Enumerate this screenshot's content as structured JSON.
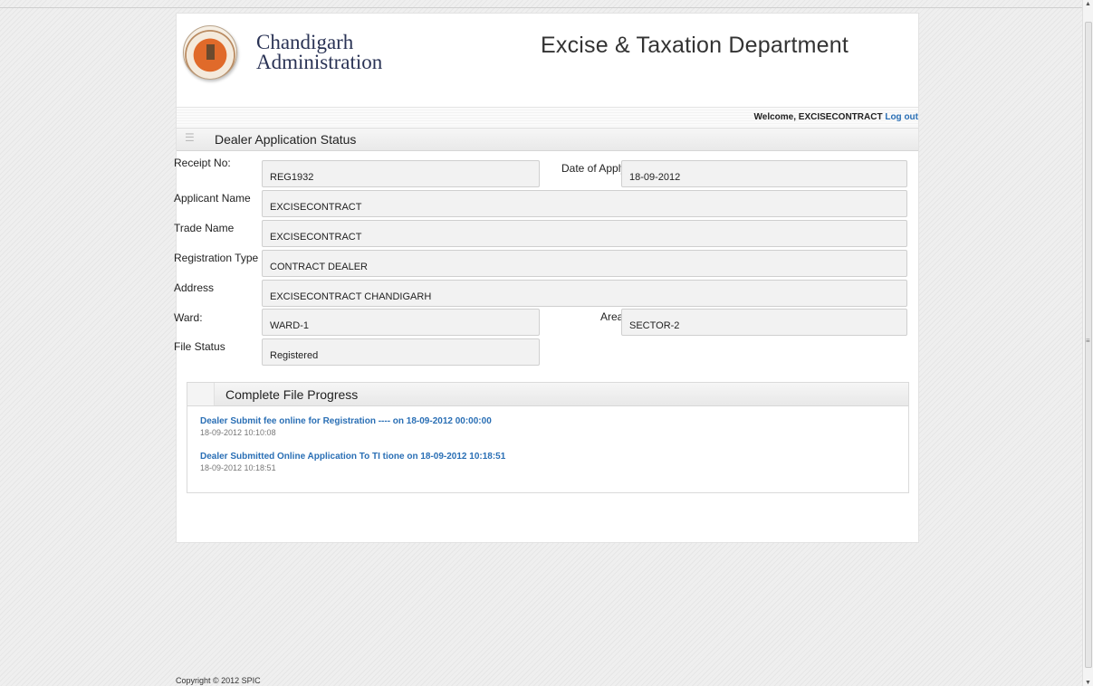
{
  "header": {
    "org_line1": "Chandigarh",
    "org_line2": "Administration",
    "department": "Excise & Taxation Department"
  },
  "welcome": {
    "text": "Welcome, EXCISECONTRACT",
    "logout": "Log out"
  },
  "section": {
    "title": "Dealer Application Status"
  },
  "form": {
    "receipt_label": "Receipt No:",
    "receipt_value": "REG1932",
    "date_label": "Date of Apply",
    "date_value": "18-09-2012",
    "applicant_label": "Applicant Name",
    "applicant_value": "EXCISECONTRACT",
    "trade_label": "Trade Name",
    "trade_value": "EXCISECONTRACT",
    "regtype_label": "Registration Type",
    "regtype_value": "CONTRACT DEALER",
    "address_label": "Address",
    "address_value": "EXCISECONTRACT CHANDIGARH",
    "ward_label": "Ward:",
    "ward_value": "WARD-1",
    "area_label": "Area",
    "area_value": "SECTOR-2",
    "status_label": "File Status",
    "status_value": "Registered"
  },
  "progress": {
    "title": "Complete File Progress",
    "entries": [
      {
        "text": "Dealer Submit fee online for Registration ---- on 18-09-2012 00:00:00",
        "time": "18-09-2012 10:10:08"
      },
      {
        "text": "Dealer Submitted Online Application To TI tione on 18-09-2012 10:18:51",
        "time": "18-09-2012 10:18:51"
      }
    ]
  },
  "footer": {
    "copyright": "Copyright © 2012 SPIC"
  },
  "colors": {
    "link": "#2a6fb5",
    "logo_accent": "#e06a2a"
  }
}
